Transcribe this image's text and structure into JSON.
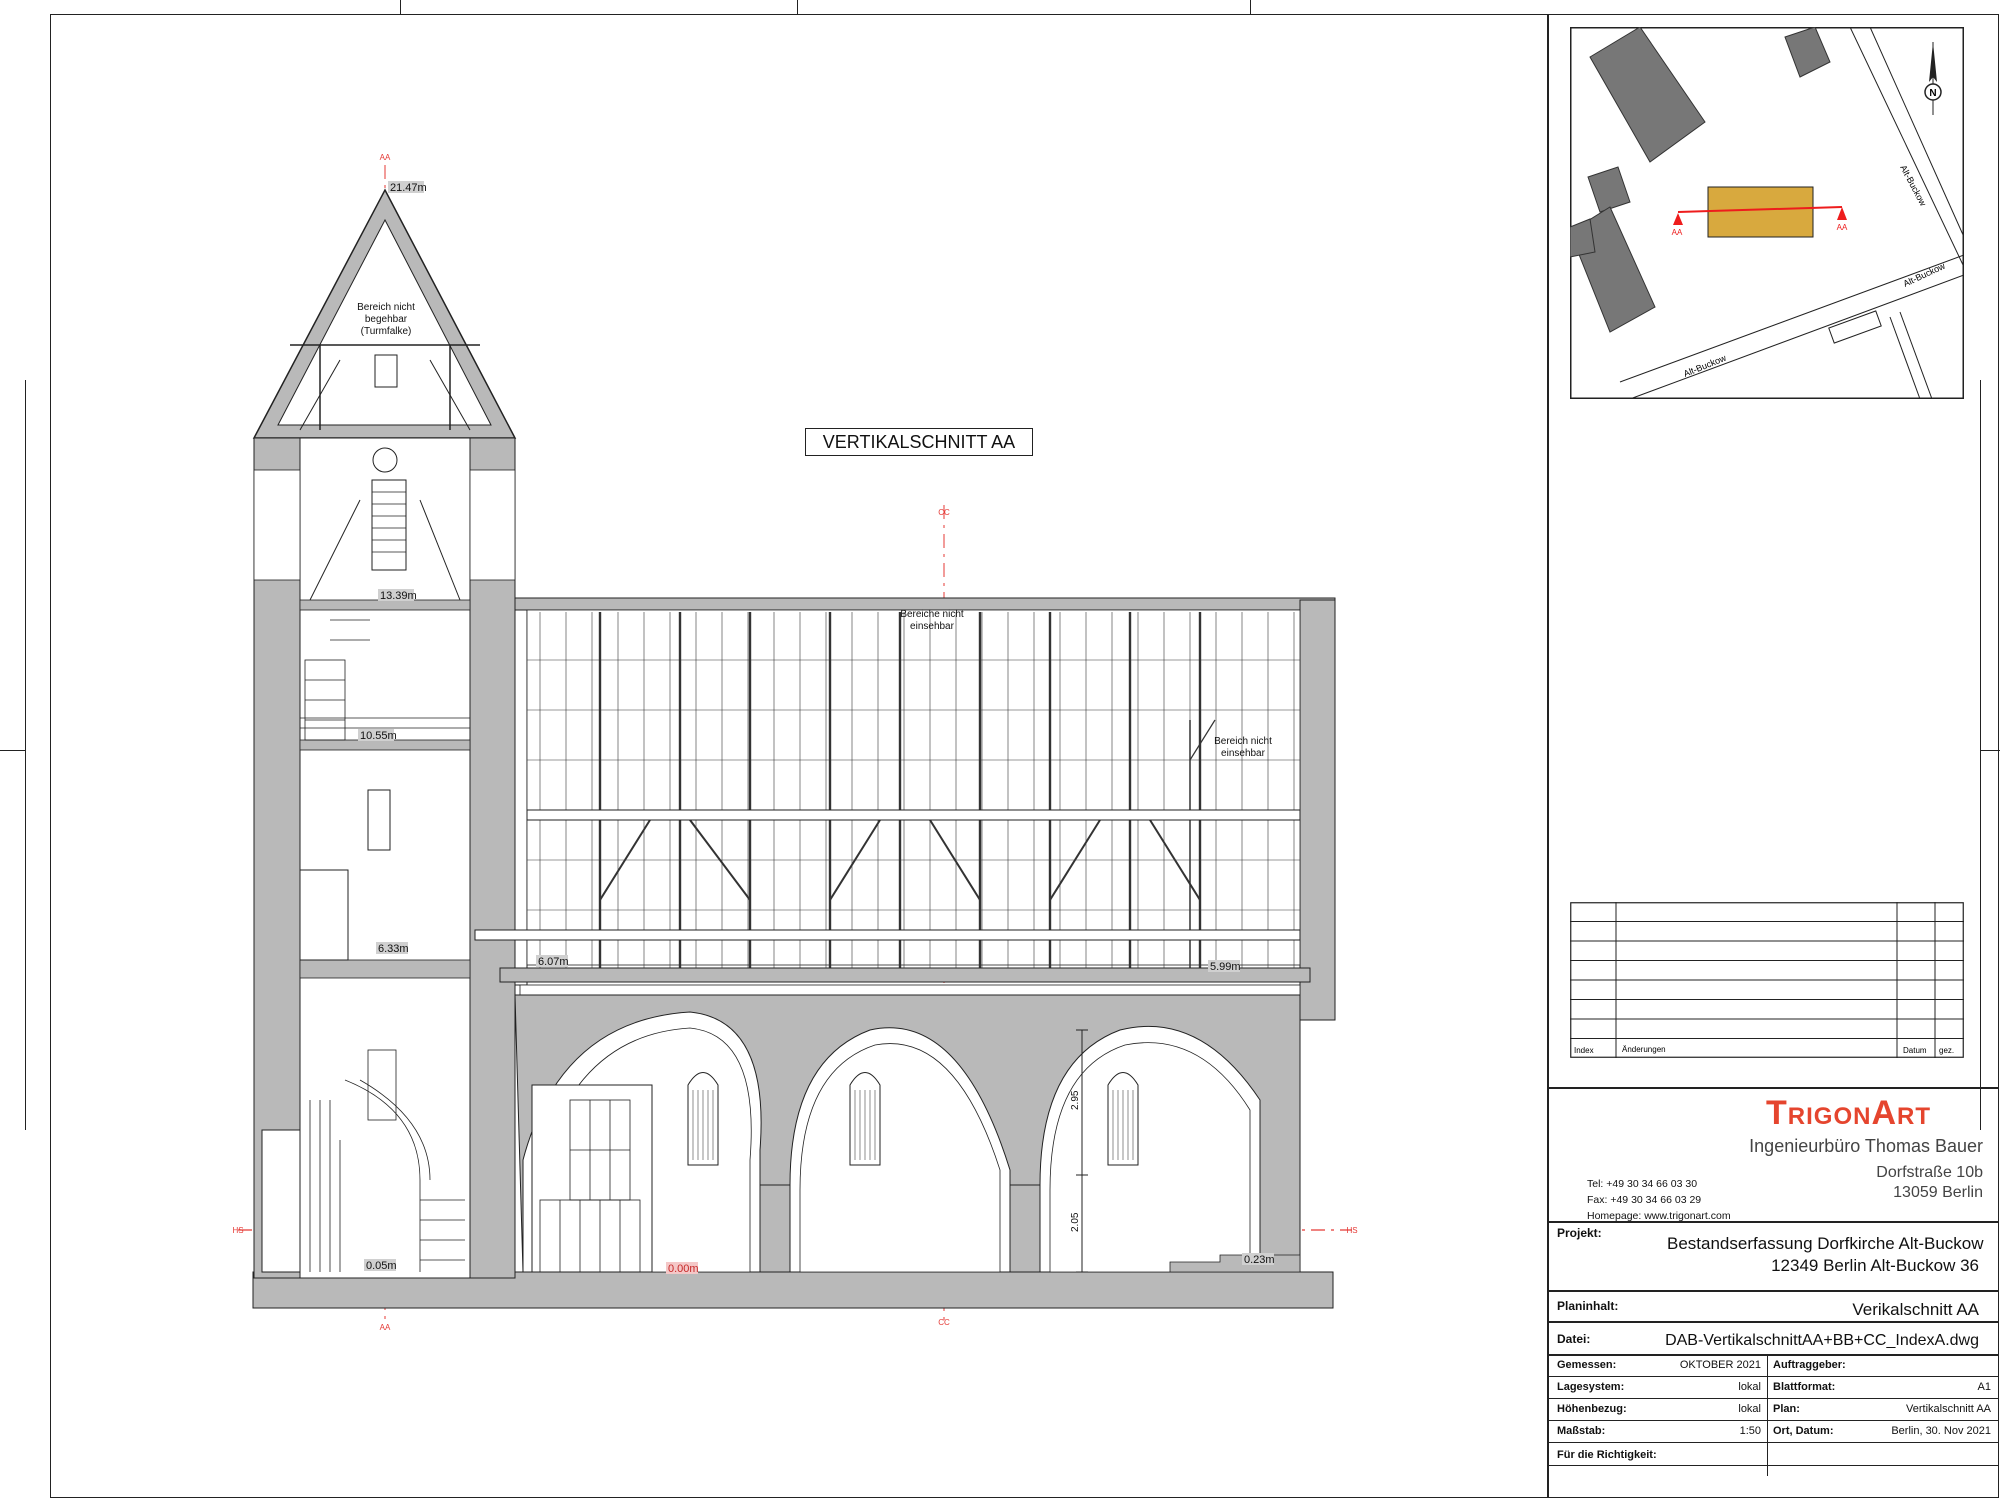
{
  "drawing": {
    "title": "VERTIKALSCHNITT AA",
    "elevations": {
      "tower_top": "21.47m",
      "tower_level_3": "13.39m",
      "tower_level_2": "10.55m",
      "tower_level_1": "6.33m",
      "tower_floor": "0.05m",
      "nave_attic_left": "6.07m",
      "nave_attic_right": "5.99m",
      "nave_floor": "0.00m",
      "chancel_floor": "0.23m"
    },
    "dimensions": {
      "vault_height": "2.95",
      "pier_height": "2.05"
    },
    "notes": {
      "tower_note": "Bereich nicht\nbegehbar\n(Turmfalke)",
      "attic_note_center": "Bereiche nicht\neinsehbar",
      "attic_note_right": "Bereich nicht\neinsehbar"
    },
    "section_markers": {
      "horizontal": "HS",
      "vertical_a": "AA",
      "vertical_c": "CC"
    }
  },
  "site_plan": {
    "section_label_left": "AA",
    "section_label_right": "AA",
    "street_labels": [
      "Alt-Buckow",
      "Alt-Buckow",
      "Alt-Buckow"
    ],
    "north_label": "N",
    "colors": {
      "church": "#d8a93e",
      "buildings": "#777777",
      "section_line": "#ee1c1c"
    }
  },
  "revision_table": {
    "headers": [
      "Index",
      "Änderungen",
      "Datum",
      "gez."
    ],
    "rows": 7
  },
  "company": {
    "brand": "TRIGONART",
    "brand_first": "T",
    "brand_mid": "RIGON",
    "brand_a": "A",
    "brand_end": "RT",
    "subtitle": "Ingenieurbüro Thomas Bauer",
    "street": "Dorfstraße 10b",
    "city": "13059 Berlin",
    "tel": "Tel:  +49 30 34 66 03 30",
    "fax": "Fax: +49 30 34 66 03 29",
    "homepage": "Homepage: www.trigonart.com",
    "color": "#e5452e"
  },
  "project": {
    "label": "Projekt:",
    "name": "Bestandserfassung Dorfkirche Alt-Buckow",
    "address": "12349 Berlin Alt-Buckow 36"
  },
  "plan_content": {
    "label": "Planinhalt:",
    "value": "Verikalschnitt AA"
  },
  "file": {
    "label": "Datei:",
    "value": "DAB-VertikalschnittAA+BB+CC_IndexA.dwg"
  },
  "info": {
    "gemessen_label": "Gemessen:",
    "gemessen_value": "OKTOBER 2021",
    "auftraggeber_label": "Auftraggeber:",
    "auftraggeber_value": "",
    "lagesystem_label": "Lagesystem:",
    "lagesystem_value": "lokal",
    "blattformat_label": "Blattformat:",
    "blattformat_value": "A1",
    "hoehenbezug_label": "Höhenbezug:",
    "hoehenbezug_value": "lokal",
    "plan_label": "Plan:",
    "plan_value": "Vertikalschnitt AA",
    "massstab_label": "Maßstab:",
    "massstab_value": "1:50",
    "ort_label": "Ort, Datum:",
    "ort_value": "Berlin, 30. Nov 2021",
    "richtigkeit_label": "Für die Richtigkeit:"
  }
}
